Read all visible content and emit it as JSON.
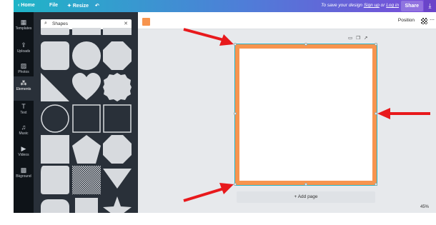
{
  "topbar": {
    "back_label": "Home",
    "file_label": "File",
    "resize_label": "Resize",
    "undo_icon": "undo-icon",
    "save_message_prefix": "To save your design ",
    "signup_link": "Sign up",
    "or_text": " or ",
    "login_link": "Log in",
    "share_label": "Share",
    "download_icon": "download-icon"
  },
  "sidebar": {
    "items": [
      {
        "label": "Templates",
        "icon": "templates-icon",
        "glyph": "▦"
      },
      {
        "label": "Uploads",
        "icon": "upload-icon",
        "glyph": "⇪"
      },
      {
        "label": "Photos",
        "icon": "photo-icon",
        "glyph": "▨"
      },
      {
        "label": "Elements",
        "icon": "elements-icon",
        "glyph": "⁂"
      },
      {
        "label": "Text",
        "icon": "text-icon",
        "glyph": "T"
      },
      {
        "label": "Music",
        "icon": "music-icon",
        "glyph": "♫"
      },
      {
        "label": "Videos",
        "icon": "video-icon",
        "glyph": "▶"
      },
      {
        "label": "Bkground",
        "icon": "background-icon",
        "glyph": "▩"
      }
    ],
    "active_index": 3
  },
  "panel": {
    "search_value": "Shapes",
    "search_icon": "search-icon",
    "clear_icon": "close-icon"
  },
  "toolbar": {
    "color_swatch": "#f7944e",
    "position_label": "Position",
    "transparency_icon": "checkerboard-icon"
  },
  "canvas": {
    "page_border_color": "#f7944e",
    "add_page_label": "+ Add page",
    "zoom_label": "45%"
  },
  "colors": {
    "accent_orange": "#f7944e",
    "arrow_red": "#e8191c",
    "panel_bg": "#293039",
    "rail_bg": "#0e1318"
  }
}
